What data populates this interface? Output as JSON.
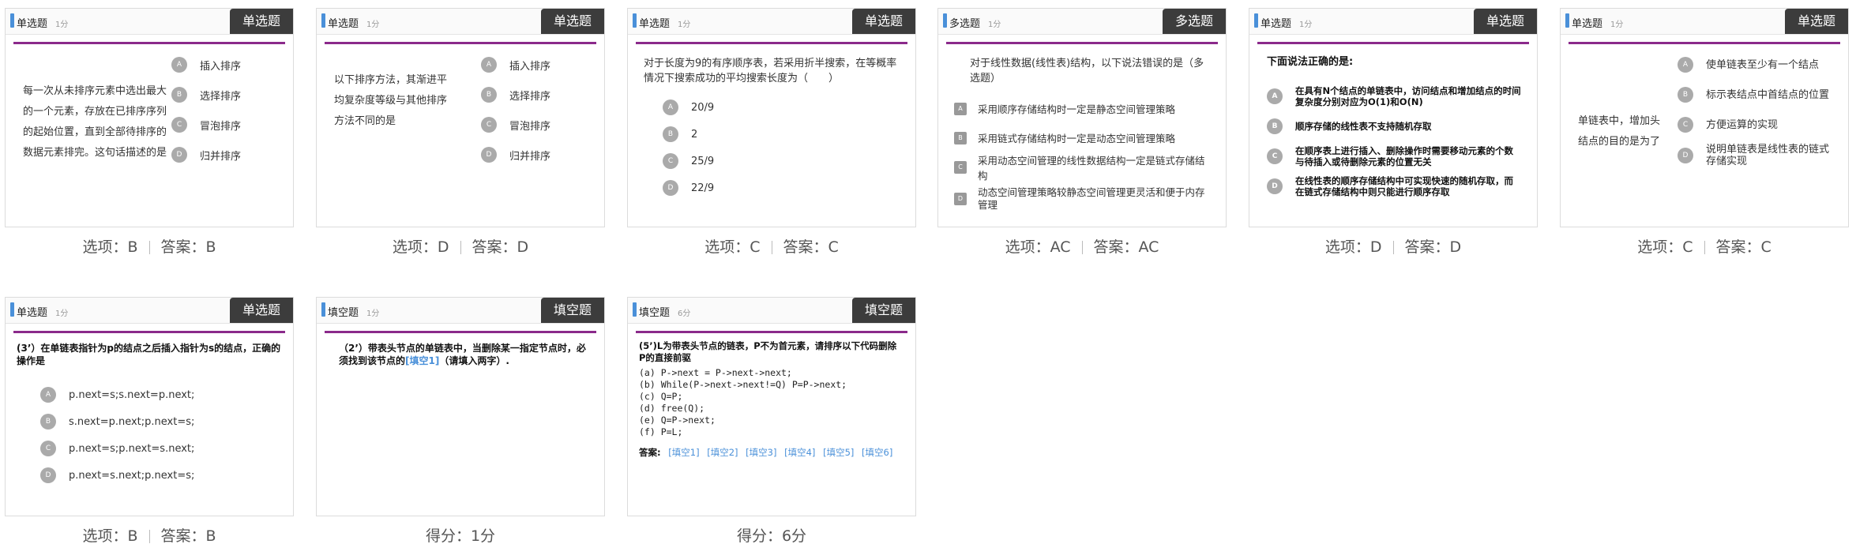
{
  "cards": [
    {
      "type": "单选题",
      "score": "1分",
      "tag": "单选题",
      "stem": "每一次从未排序元素中选出最大的一个元素，存放在已排序序列的起始位置，直到全部待排序的数据元素排完。这句话描述的是",
      "options": [
        {
          "letter": "A",
          "text": "插入排序"
        },
        {
          "letter": "B",
          "text": "选择排序"
        },
        {
          "letter": "C",
          "text": "冒泡排序"
        },
        {
          "letter": "D",
          "text": "归并排序"
        }
      ],
      "caption": {
        "choice": "选项：B",
        "answer": "答案：B"
      }
    },
    {
      "type": "单选题",
      "score": "1分",
      "tag": "单选题",
      "stem": "以下排序方法，其渐进平均复杂度等级与其他排序方法不同的是",
      "options": [
        {
          "letter": "A",
          "text": "插入排序"
        },
        {
          "letter": "B",
          "text": "选择排序"
        },
        {
          "letter": "C",
          "text": "冒泡排序"
        },
        {
          "letter": "D",
          "text": "归并排序"
        }
      ],
      "caption": {
        "choice": "选项：D",
        "answer": "答案：D"
      }
    },
    {
      "type": "单选题",
      "score": "1分",
      "tag": "单选题",
      "stem": "对于长度为9的有序顺序表，若采用折半搜索，在等概率情况下搜索成功的平均搜索长度为（　　）",
      "options": [
        {
          "letter": "A",
          "text": "20/9"
        },
        {
          "letter": "B",
          "text": "2"
        },
        {
          "letter": "C",
          "text": "25/9"
        },
        {
          "letter": "D",
          "text": "22/9"
        }
      ],
      "caption": {
        "choice": "选项：C",
        "answer": "答案：C"
      }
    },
    {
      "type": "多选题",
      "score": "1分",
      "tag": "多选题",
      "stem": "对于线性数据(线性表)结构，以下说法错误的是（多选题）",
      "options": [
        {
          "letter": "A",
          "text": "采用顺序存储结构时一定是静态空间管理策略"
        },
        {
          "letter": "B",
          "text": "采用链式存储结构时一定是动态空间管理策略"
        },
        {
          "letter": "C",
          "text": "采用动态空间管理的线性数据结构一定是链式存储结构"
        },
        {
          "letter": "D",
          "text": "动态空间管理策略较静态空间管理更灵活和便于内存管理"
        }
      ],
      "caption": {
        "choice": "选项：AC",
        "answer": "答案：AC"
      }
    },
    {
      "type": "单选题",
      "score": "1分",
      "tag": "单选题",
      "stem": "下面说法正确的是:",
      "options": [
        {
          "letter": "A",
          "text": "在具有N个结点的单链表中，访问结点和增加结点的时间复杂度分别对应为O(1)和O(N)"
        },
        {
          "letter": "B",
          "text": "顺序存储的线性表不支持随机存取"
        },
        {
          "letter": "C",
          "text": "在顺序表上进行插入、删除操作时需要移动元素的个数与待插入或待删除元素的位置无关"
        },
        {
          "letter": "D",
          "text": "在线性表的顺序存储结构中可实现快速的随机存取，而在链式存储结构中则只能进行顺序存取"
        }
      ],
      "caption": {
        "choice": "选项：D",
        "answer": "答案：D"
      }
    },
    {
      "type": "单选题",
      "score": "1分",
      "tag": "单选题",
      "stem": "单链表中，增加头结点的目的是为了",
      "options": [
        {
          "letter": "A",
          "text": "使单链表至少有一个结点"
        },
        {
          "letter": "B",
          "text": "标示表结点中首结点的位置"
        },
        {
          "letter": "C",
          "text": "方便运算的实现"
        },
        {
          "letter": "D",
          "text": "说明单链表是线性表的链式存储实现"
        }
      ],
      "caption": {
        "choice": "选项：C",
        "answer": "答案：C"
      }
    },
    {
      "type": "单选题",
      "score": "1分",
      "tag": "单选题",
      "stem": "(3’）在单链表指针为p的结点之后插入指针为s的结点，正确的操作是",
      "options": [
        {
          "letter": "A",
          "text": "p.next=s;s.next=p.next;"
        },
        {
          "letter": "B",
          "text": "s.next=p.next;p.next=s;"
        },
        {
          "letter": "C",
          "text": "p.next=s;p.next=s.next;"
        },
        {
          "letter": "D",
          "text": "p.next=s.next;p.next=s;"
        }
      ],
      "caption": {
        "choice": "选项：B",
        "answer": "答案：B"
      }
    },
    {
      "type": "填空题",
      "score": "1分",
      "tag": "填空题",
      "stem_pre": "（2’）带表头节点的单链表中，当删除某一指定节点时，必须找到该节点的",
      "blank": "[填空1]",
      "stem_post": "（请填入两字）.",
      "caption": {
        "score": "得分：1分"
      }
    },
    {
      "type": "填空题",
      "score": "6分",
      "tag": "填空题",
      "stem": "(5’)L为带表头节点的链表，P不为首元素，请排序以下代码删除P的直接前驱",
      "code": "(a) P->next = P->next->next;\n(b) While(P->next->next!=Q) P=P->next;\n(c) Q=P;\n(d) free(Q);\n(e) Q=P->next;\n(f) P=L;",
      "answer_label": "答案:",
      "blanks": [
        "[填空1]",
        "[填空2]",
        "[填空3]",
        "[填空4]",
        "[填空5]",
        "[填空6]"
      ],
      "caption": {
        "score": "得分：6分"
      }
    }
  ]
}
